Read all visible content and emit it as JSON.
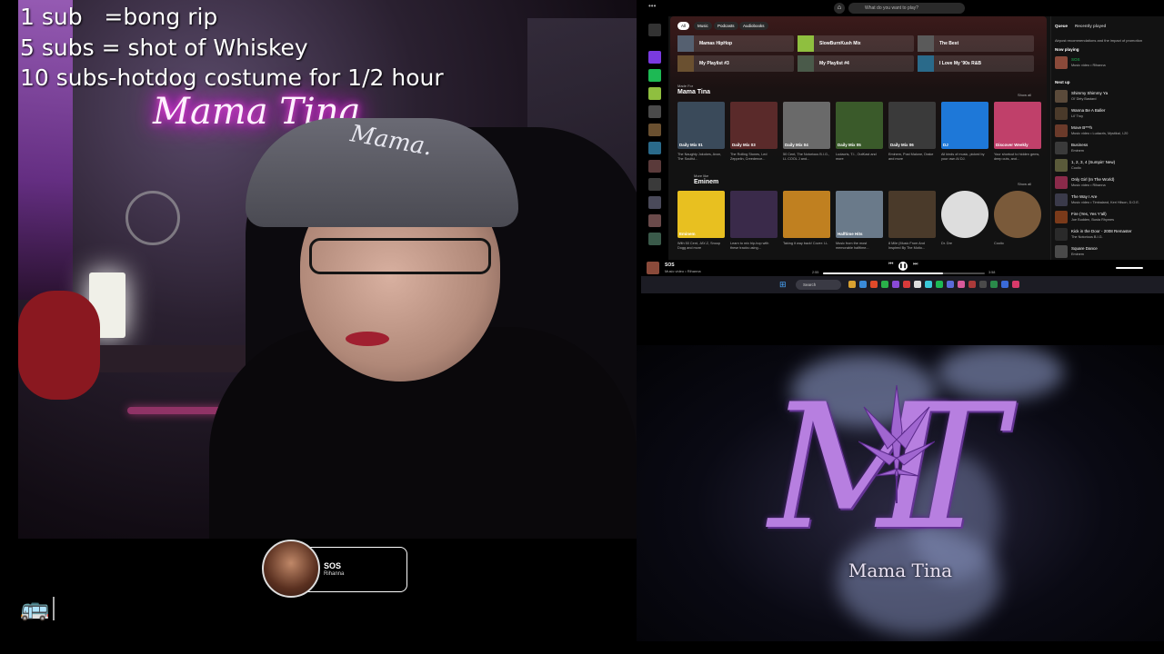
{
  "overlay": {
    "line1": "1 sub   =bong rip",
    "line2": "5 subs = shot of Whiskey",
    "line3": "10 subs-hotdog costume for 1/2 hour",
    "bus_icon": "bus-icon"
  },
  "webcam": {
    "neon_sign": "Mama Tina",
    "cap_text": "Mama."
  },
  "now_playing_widget": {
    "title": "SOS",
    "artist": "Rihanna"
  },
  "spotify": {
    "search_placeholder": "What do you want to play?",
    "chips": [
      "All",
      "Music",
      "Podcasts",
      "Audiobooks"
    ],
    "shortcuts": [
      {
        "label": "Mamas HipHop",
        "color": "#556070"
      },
      {
        "label": "SlowBurnKush Mix",
        "color": "#8fbf3f"
      },
      {
        "label": "The Best",
        "color": "#5a5a5a"
      },
      {
        "label": "My Playlist #3",
        "color": "#6a5030"
      },
      {
        "label": "My Playlist #4",
        "color": "#4a5a4a"
      },
      {
        "label": "I Love My '90s R&B",
        "color": "#2a6a8a"
      }
    ],
    "made_for_label": "Made For",
    "made_for_title": "Mama Tina",
    "show_all": "Show all",
    "mixes": [
      {
        "label": "Daily Mix 01",
        "desc": "The Naughty Jokokes, Avon, The Soulful...",
        "color": "#3a4a5a"
      },
      {
        "label": "Daily Mix 03",
        "desc": "The Rolling Stones, Led Zeppelin, Creedence...",
        "color": "#5a2a2a"
      },
      {
        "label": "Daily Mix 04",
        "desc": "50 Cent, The Notorious B.I.G., LL COOL J and...",
        "color": "#6a6a6a"
      },
      {
        "label": "Daily Mix 05",
        "desc": "Ludacris, T.I., OutKast and more",
        "color": "#3a5a2a"
      },
      {
        "label": "Daily Mix 06",
        "desc": "Eminem, Post Malone, Drake and more",
        "color": "#3a3a3a"
      },
      {
        "label": "DJ",
        "desc": "All kinds of music, picked by your own AI DJ.",
        "color": "#1e78d8"
      },
      {
        "label": "Discover Weekly",
        "desc": "Your shortcut to hidden gems, deep cuts, and...",
        "color": "#c0406a"
      }
    ],
    "more_like_label": "More like",
    "more_like_title": "Eminem",
    "artists": [
      {
        "label": "Eminem",
        "desc": "With 50 Cent, JAY-Z, Snoop Dogg and more",
        "color": "#e8c020"
      },
      {
        "label": "",
        "desc": "Learn to mix hip-hop with these tracks using...",
        "color": "#3a2a4a"
      },
      {
        "label": "",
        "desc": "Taking it way back! Cover: LL",
        "color": "#c08020"
      },
      {
        "label": "Halftime Hits",
        "desc": "Music from the most memorable halftime...",
        "color": "#6a7a8a"
      },
      {
        "label": "",
        "desc": "8 Mile (Music From And Inspired By The Motio...",
        "color": "#4a3a2a"
      },
      {
        "label": "",
        "desc": "Dr. Dre",
        "color": "#dddddd"
      },
      {
        "label": "",
        "desc": "Coolio",
        "color": "#7a5a3a"
      }
    ],
    "artist_captions": [
      "8 Mile (Music From And Inspired By The Motio...",
      "Dr. Dre",
      "Coolio"
    ],
    "queue_tabs": [
      "Queue",
      "Recently played"
    ],
    "queue_notice": "Airpost recommendations and the impact of promotion",
    "now_playing_head": "Now playing",
    "now_playing": {
      "title": "SOS",
      "sub": "Music video • Rihanna"
    },
    "next_up_head": "Next up",
    "queue": [
      {
        "title": "Shimmy Shimmy Ya",
        "sub": "Ol' Dirty Bastard",
        "color": "#5a4a3a"
      },
      {
        "title": "Wanna Be A Baller",
        "sub": "Lil' Troy",
        "color": "#4a3a2a"
      },
      {
        "title": "Move B***h",
        "sub": "Music video • Ludacris, Mystikal, I-20",
        "color": "#6a3a2a"
      },
      {
        "title": "Business",
        "sub": "Eminem",
        "color": "#3a3a3a"
      },
      {
        "title": "1, 2, 3, 4 (Sumpin' New)",
        "sub": "Coolio",
        "color": "#5a5a3a"
      },
      {
        "title": "Only Girl (In The World)",
        "sub": "Music video • Rihanna",
        "color": "#8a2a4a"
      },
      {
        "title": "The Way I Are",
        "sub": "Music video • Timbaland, Keri Hilson, D.O.E.",
        "color": "#3a3a4a"
      },
      {
        "title": "Fire (Yes, Yes Y'all)",
        "sub": "Joe Budden, Busta Rhymes",
        "color": "#7a3a1a"
      },
      {
        "title": "Kick in the Door - 2008 Remaster",
        "sub": "The Notorious B.I.G.",
        "color": "#2a2a2a"
      },
      {
        "title": "Square Dance",
        "sub": "Eminem",
        "color": "#4a4a4a"
      }
    ],
    "player": {
      "title": "SOS",
      "sub": "Music video • Rihanna",
      "elapsed": "2:55",
      "duration": "3:58",
      "progress": 0.74
    },
    "taskbar_search": "Search"
  },
  "logo": {
    "monogram": "MT",
    "name": "Mama Tina"
  }
}
